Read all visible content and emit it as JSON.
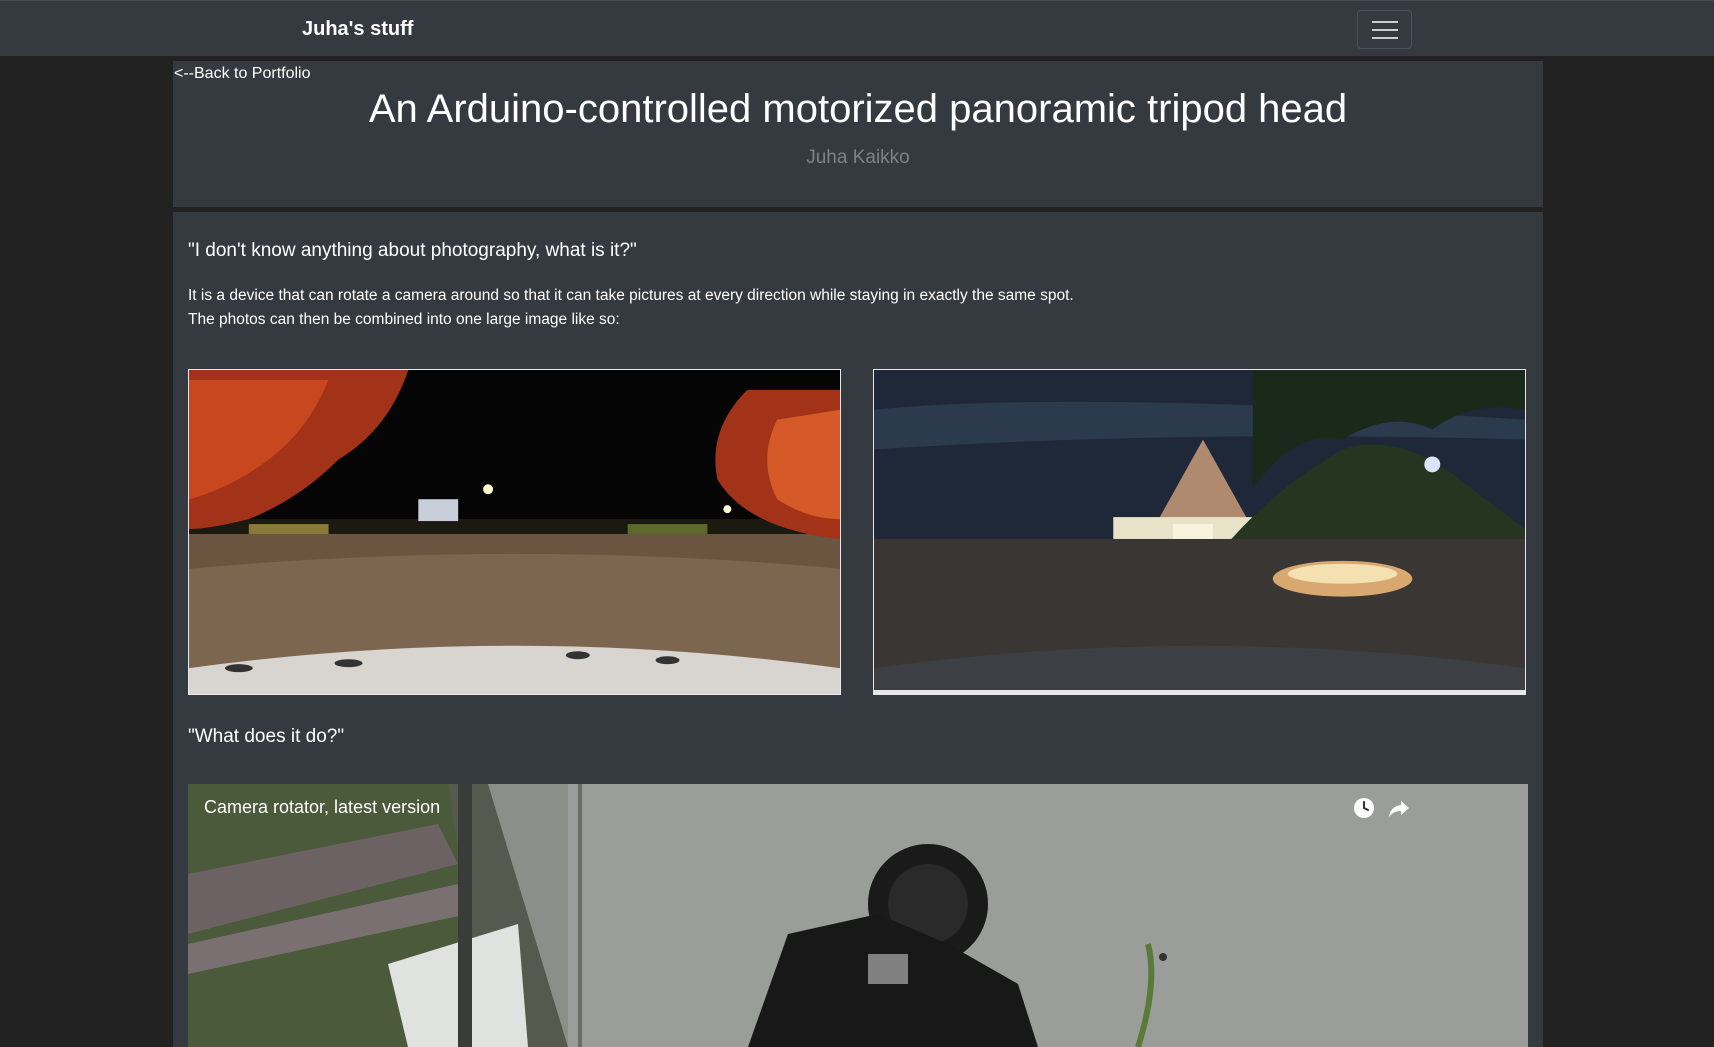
{
  "navbar": {
    "brand": "Juha's stuff",
    "menu_icon": "hamburger-menu-icon"
  },
  "header": {
    "back_link": "<--Back to Portfolio",
    "title": "An Arduino-controlled motorized panoramic tripod head",
    "author": "Juha Kaikko"
  },
  "content": {
    "question1": "\"I don't know anything about photography, what is it?\"",
    "description_line1": "It is a device that can rotate a camera around so that it can take pictures at every direction while staying in exactly the same spot.",
    "description_line2": "The photos can then be combined into one large image like so:",
    "question2": "\"What does it do?\""
  },
  "video": {
    "title": "Camera rotator, latest version",
    "icons": [
      "clock-icon",
      "share-icon"
    ]
  },
  "colors": {
    "page_bg": "#222222",
    "panel_bg": "#343a40",
    "muted_text": "#7c8288"
  }
}
